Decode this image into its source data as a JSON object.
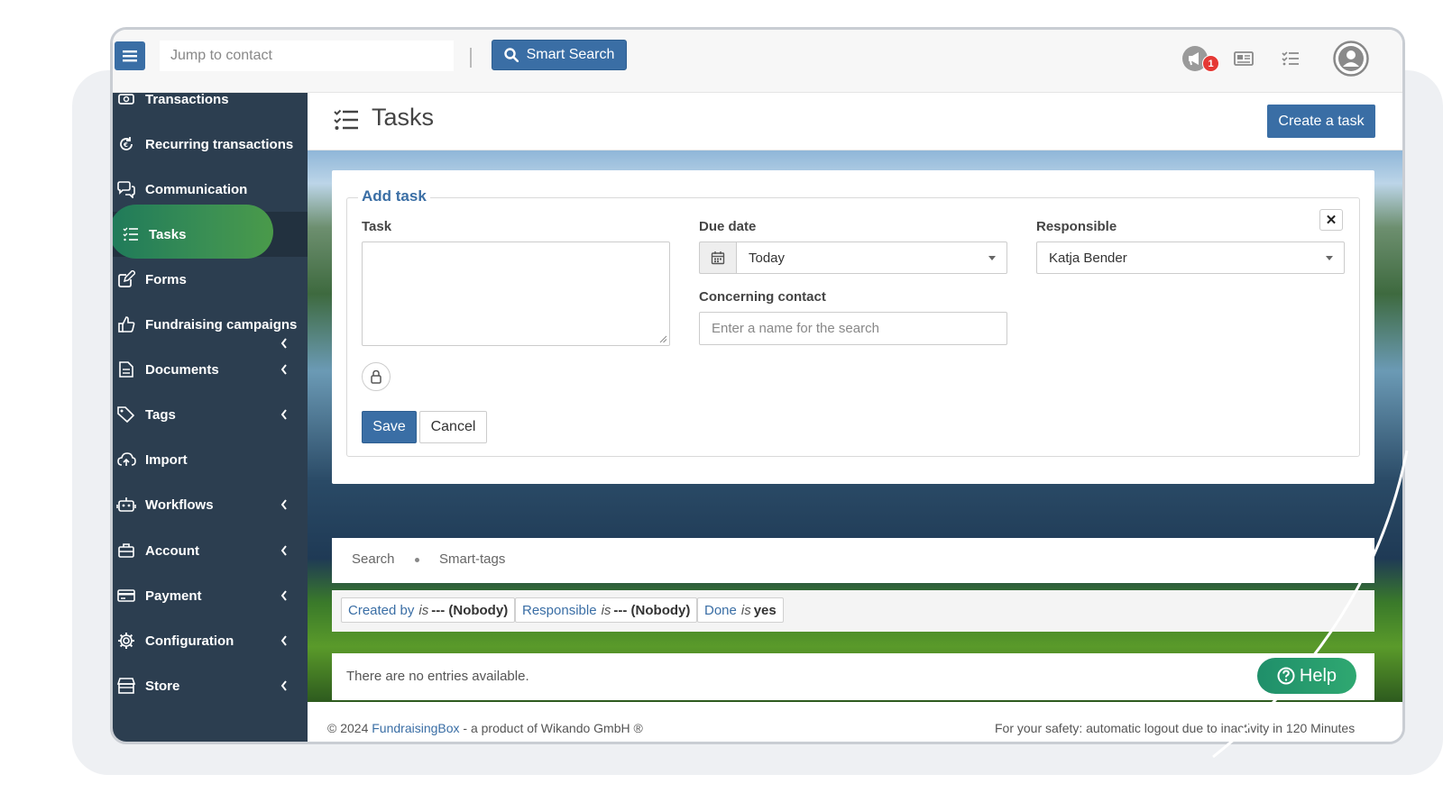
{
  "topbar": {
    "jump_placeholder": "Jump to contact",
    "smart_search_label": "Smart Search",
    "notification_count": "1"
  },
  "sidebar": {
    "items": [
      {
        "label": "Transactions",
        "icon": "transactions-icon",
        "has_chevron": false
      },
      {
        "label": "Recurring transactions",
        "icon": "recurring-icon",
        "has_chevron": false
      },
      {
        "label": "Communication",
        "icon": "chat-icon",
        "has_chevron": false
      },
      {
        "label": "Tasks",
        "icon": "tasks-icon",
        "has_chevron": false,
        "active": true
      },
      {
        "label": "Forms",
        "icon": "edit-icon",
        "has_chevron": false
      },
      {
        "label": "Fundraising campaigns",
        "icon": "thumbs-up-icon",
        "has_chevron": true
      },
      {
        "label": "Documents",
        "icon": "document-icon",
        "has_chevron": true
      },
      {
        "label": "Tags",
        "icon": "tag-icon",
        "has_chevron": true
      },
      {
        "label": "Import",
        "icon": "cloud-upload-icon",
        "has_chevron": false
      },
      {
        "label": "Workflows",
        "icon": "robot-icon",
        "has_chevron": true
      },
      {
        "label": "Account",
        "icon": "briefcase-icon",
        "has_chevron": true
      },
      {
        "label": "Payment",
        "icon": "credit-card-icon",
        "has_chevron": true
      },
      {
        "label": "Configuration",
        "icon": "gear-icon",
        "has_chevron": true
      },
      {
        "label": "Store",
        "icon": "store-icon",
        "has_chevron": true
      }
    ]
  },
  "page": {
    "title": "Tasks",
    "create_button": "Create a task"
  },
  "form": {
    "legend": "Add task",
    "task_label": "Task",
    "due_date_label": "Due date",
    "due_date_value": "Today",
    "responsible_label": "Responsible",
    "responsible_value": "Katja Bender",
    "concerning_label": "Concerning contact",
    "concerning_placeholder": "Enter a name for the search",
    "save_label": "Save",
    "cancel_label": "Cancel"
  },
  "tabs": [
    "Search",
    "Smart-tags"
  ],
  "filters": [
    {
      "field": "Created by",
      "op": "is",
      "value": "--- (Nobody)"
    },
    {
      "field": "Responsible",
      "op": "is",
      "value": "--- (Nobody)"
    },
    {
      "field": "Done",
      "op": "is",
      "value": "yes"
    }
  ],
  "empty_message": "There are no entries available.",
  "footer": {
    "copyright_prefix": "© 2024 ",
    "brand": "FundraisingBox",
    "copyright_suffix": " - a product of Wikando GmbH ®",
    "logout_notice": "For your safety: automatic logout due to inactivity in 120 Minutes"
  },
  "help_label": "Help",
  "colors": {
    "primary": "#3a6ea5",
    "sidebar": "#2c3e50",
    "active_pill": "#2f8a5a",
    "badge": "#e53935"
  }
}
